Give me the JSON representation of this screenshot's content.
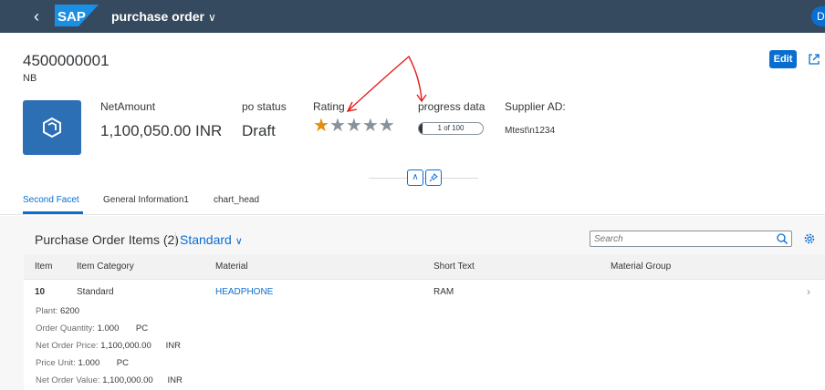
{
  "shell": {
    "logo_text": "SAP",
    "title": "purchase order",
    "avatar_initials": "DU"
  },
  "header": {
    "title": "4500000001",
    "subtitle": "NB",
    "edit_label": "Edit",
    "kpis": {
      "net_amount_label": "NetAmount",
      "net_amount_value": "1,100,050.00  INR",
      "status_label": "po status",
      "status_value": "Draft",
      "rating_label": "Rating",
      "rating_value": 1,
      "rating_max": 5,
      "progress_label": "progress data",
      "progress_text": "1 of 100",
      "progress_value": 1,
      "progress_max": 100,
      "supplier_label": "Supplier AD:",
      "supplier_value": "Mtest\\n1234"
    }
  },
  "tabs": [
    {
      "label": "Second Facet",
      "active": true
    },
    {
      "label": "General Information1",
      "active": false
    },
    {
      "label": "chart_head",
      "active": false
    }
  ],
  "table": {
    "title": "Purchase Order Items (2)",
    "variant": "Standard",
    "search_placeholder": "Search",
    "columns": [
      "Item",
      "Item Category",
      "Material",
      "Short Text",
      "Material Group"
    ],
    "rows": [
      {
        "item": "10",
        "category": "Standard",
        "material": "HEADPHONE",
        "short_text": "RAM",
        "material_group": "",
        "details": [
          {
            "label": "Plant:",
            "value": "6200",
            "unit": ""
          },
          {
            "label": "Order Quantity:",
            "value": "1.000",
            "unit": "PC"
          },
          {
            "label": "Net Order Price:",
            "value": "1,100,000.00",
            "unit": "INR"
          },
          {
            "label": "Price Unit:",
            "value": "1.000",
            "unit": "PC"
          },
          {
            "label": "Net Order Value:",
            "value": "1,100,000.00",
            "unit": "INR"
          }
        ]
      }
    ]
  },
  "colors": {
    "shell": "#354a5f",
    "accent": "#0a6ed1",
    "rating": "#e78c07",
    "annotation": "#e0201b"
  }
}
